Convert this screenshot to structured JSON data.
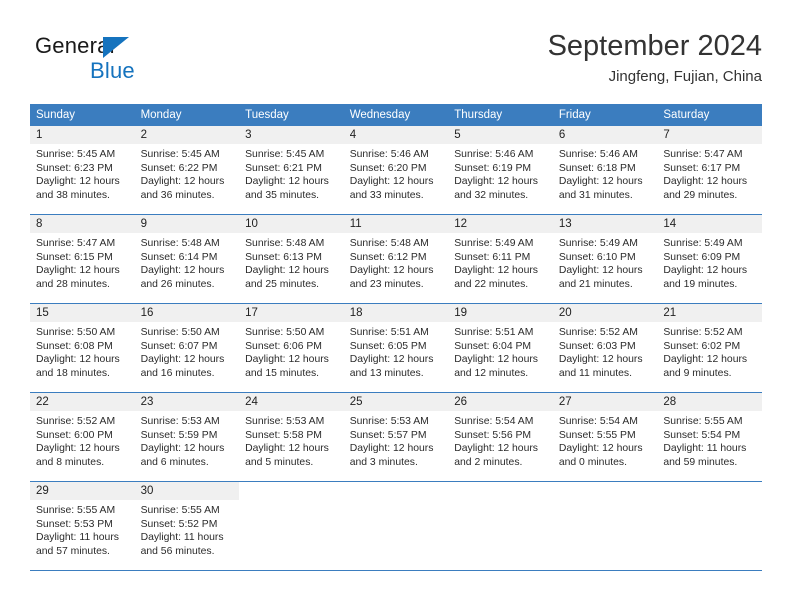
{
  "logo": {
    "primary_text": "General",
    "secondary_text": "Blue",
    "triangle_icon": "blue-triangle-icon",
    "primary_color": "#1a1a1a",
    "secondary_color": "#1573be"
  },
  "header": {
    "title": "September 2024",
    "subtitle": "Jingfeng, Fujian, China"
  },
  "theme": {
    "header_bg": "#3b7dbf",
    "header_text": "#ffffff",
    "daynum_bg": "#f0f0f0",
    "row_separator": "#3b7dbf"
  },
  "weekday_headers": [
    "Sunday",
    "Monday",
    "Tuesday",
    "Wednesday",
    "Thursday",
    "Friday",
    "Saturday"
  ],
  "labels": {
    "sunrise_prefix": "Sunrise:",
    "sunset_prefix": "Sunset:",
    "daylight_prefix": "Daylight:"
  },
  "weeks": [
    [
      {
        "day": "1",
        "sunrise": "Sunrise: 5:45 AM",
        "sunset": "Sunset: 6:23 PM",
        "daylight_line1": "Daylight: 12 hours",
        "daylight_line2": "and 38 minutes."
      },
      {
        "day": "2",
        "sunrise": "Sunrise: 5:45 AM",
        "sunset": "Sunset: 6:22 PM",
        "daylight_line1": "Daylight: 12 hours",
        "daylight_line2": "and 36 minutes."
      },
      {
        "day": "3",
        "sunrise": "Sunrise: 5:45 AM",
        "sunset": "Sunset: 6:21 PM",
        "daylight_line1": "Daylight: 12 hours",
        "daylight_line2": "and 35 minutes."
      },
      {
        "day": "4",
        "sunrise": "Sunrise: 5:46 AM",
        "sunset": "Sunset: 6:20 PM",
        "daylight_line1": "Daylight: 12 hours",
        "daylight_line2": "and 33 minutes."
      },
      {
        "day": "5",
        "sunrise": "Sunrise: 5:46 AM",
        "sunset": "Sunset: 6:19 PM",
        "daylight_line1": "Daylight: 12 hours",
        "daylight_line2": "and 32 minutes."
      },
      {
        "day": "6",
        "sunrise": "Sunrise: 5:46 AM",
        "sunset": "Sunset: 6:18 PM",
        "daylight_line1": "Daylight: 12 hours",
        "daylight_line2": "and 31 minutes."
      },
      {
        "day": "7",
        "sunrise": "Sunrise: 5:47 AM",
        "sunset": "Sunset: 6:17 PM",
        "daylight_line1": "Daylight: 12 hours",
        "daylight_line2": "and 29 minutes."
      }
    ],
    [
      {
        "day": "8",
        "sunrise": "Sunrise: 5:47 AM",
        "sunset": "Sunset: 6:15 PM",
        "daylight_line1": "Daylight: 12 hours",
        "daylight_line2": "and 28 minutes."
      },
      {
        "day": "9",
        "sunrise": "Sunrise: 5:48 AM",
        "sunset": "Sunset: 6:14 PM",
        "daylight_line1": "Daylight: 12 hours",
        "daylight_line2": "and 26 minutes."
      },
      {
        "day": "10",
        "sunrise": "Sunrise: 5:48 AM",
        "sunset": "Sunset: 6:13 PM",
        "daylight_line1": "Daylight: 12 hours",
        "daylight_line2": "and 25 minutes."
      },
      {
        "day": "11",
        "sunrise": "Sunrise: 5:48 AM",
        "sunset": "Sunset: 6:12 PM",
        "daylight_line1": "Daylight: 12 hours",
        "daylight_line2": "and 23 minutes."
      },
      {
        "day": "12",
        "sunrise": "Sunrise: 5:49 AM",
        "sunset": "Sunset: 6:11 PM",
        "daylight_line1": "Daylight: 12 hours",
        "daylight_line2": "and 22 minutes."
      },
      {
        "day": "13",
        "sunrise": "Sunrise: 5:49 AM",
        "sunset": "Sunset: 6:10 PM",
        "daylight_line1": "Daylight: 12 hours",
        "daylight_line2": "and 21 minutes."
      },
      {
        "day": "14",
        "sunrise": "Sunrise: 5:49 AM",
        "sunset": "Sunset: 6:09 PM",
        "daylight_line1": "Daylight: 12 hours",
        "daylight_line2": "and 19 minutes."
      }
    ],
    [
      {
        "day": "15",
        "sunrise": "Sunrise: 5:50 AM",
        "sunset": "Sunset: 6:08 PM",
        "daylight_line1": "Daylight: 12 hours",
        "daylight_line2": "and 18 minutes."
      },
      {
        "day": "16",
        "sunrise": "Sunrise: 5:50 AM",
        "sunset": "Sunset: 6:07 PM",
        "daylight_line1": "Daylight: 12 hours",
        "daylight_line2": "and 16 minutes."
      },
      {
        "day": "17",
        "sunrise": "Sunrise: 5:50 AM",
        "sunset": "Sunset: 6:06 PM",
        "daylight_line1": "Daylight: 12 hours",
        "daylight_line2": "and 15 minutes."
      },
      {
        "day": "18",
        "sunrise": "Sunrise: 5:51 AM",
        "sunset": "Sunset: 6:05 PM",
        "daylight_line1": "Daylight: 12 hours",
        "daylight_line2": "and 13 minutes."
      },
      {
        "day": "19",
        "sunrise": "Sunrise: 5:51 AM",
        "sunset": "Sunset: 6:04 PM",
        "daylight_line1": "Daylight: 12 hours",
        "daylight_line2": "and 12 minutes."
      },
      {
        "day": "20",
        "sunrise": "Sunrise: 5:52 AM",
        "sunset": "Sunset: 6:03 PM",
        "daylight_line1": "Daylight: 12 hours",
        "daylight_line2": "and 11 minutes."
      },
      {
        "day": "21",
        "sunrise": "Sunrise: 5:52 AM",
        "sunset": "Sunset: 6:02 PM",
        "daylight_line1": "Daylight: 12 hours",
        "daylight_line2": "and 9 minutes."
      }
    ],
    [
      {
        "day": "22",
        "sunrise": "Sunrise: 5:52 AM",
        "sunset": "Sunset: 6:00 PM",
        "daylight_line1": "Daylight: 12 hours",
        "daylight_line2": "and 8 minutes."
      },
      {
        "day": "23",
        "sunrise": "Sunrise: 5:53 AM",
        "sunset": "Sunset: 5:59 PM",
        "daylight_line1": "Daylight: 12 hours",
        "daylight_line2": "and 6 minutes."
      },
      {
        "day": "24",
        "sunrise": "Sunrise: 5:53 AM",
        "sunset": "Sunset: 5:58 PM",
        "daylight_line1": "Daylight: 12 hours",
        "daylight_line2": "and 5 minutes."
      },
      {
        "day": "25",
        "sunrise": "Sunrise: 5:53 AM",
        "sunset": "Sunset: 5:57 PM",
        "daylight_line1": "Daylight: 12 hours",
        "daylight_line2": "and 3 minutes."
      },
      {
        "day": "26",
        "sunrise": "Sunrise: 5:54 AM",
        "sunset": "Sunset: 5:56 PM",
        "daylight_line1": "Daylight: 12 hours",
        "daylight_line2": "and 2 minutes."
      },
      {
        "day": "27",
        "sunrise": "Sunrise: 5:54 AM",
        "sunset": "Sunset: 5:55 PM",
        "daylight_line1": "Daylight: 12 hours",
        "daylight_line2": "and 0 minutes."
      },
      {
        "day": "28",
        "sunrise": "Sunrise: 5:55 AM",
        "sunset": "Sunset: 5:54 PM",
        "daylight_line1": "Daylight: 11 hours",
        "daylight_line2": "and 59 minutes."
      }
    ],
    [
      {
        "day": "29",
        "sunrise": "Sunrise: 5:55 AM",
        "sunset": "Sunset: 5:53 PM",
        "daylight_line1": "Daylight: 11 hours",
        "daylight_line2": "and 57 minutes."
      },
      {
        "day": "30",
        "sunrise": "Sunrise: 5:55 AM",
        "sunset": "Sunset: 5:52 PM",
        "daylight_line1": "Daylight: 11 hours",
        "daylight_line2": "and 56 minutes."
      },
      {
        "day": "",
        "sunrise": "",
        "sunset": "",
        "daylight_line1": "",
        "daylight_line2": ""
      },
      {
        "day": "",
        "sunrise": "",
        "sunset": "",
        "daylight_line1": "",
        "daylight_line2": ""
      },
      {
        "day": "",
        "sunrise": "",
        "sunset": "",
        "daylight_line1": "",
        "daylight_line2": ""
      },
      {
        "day": "",
        "sunrise": "",
        "sunset": "",
        "daylight_line1": "",
        "daylight_line2": ""
      },
      {
        "day": "",
        "sunrise": "",
        "sunset": "",
        "daylight_line1": "",
        "daylight_line2": ""
      }
    ]
  ]
}
